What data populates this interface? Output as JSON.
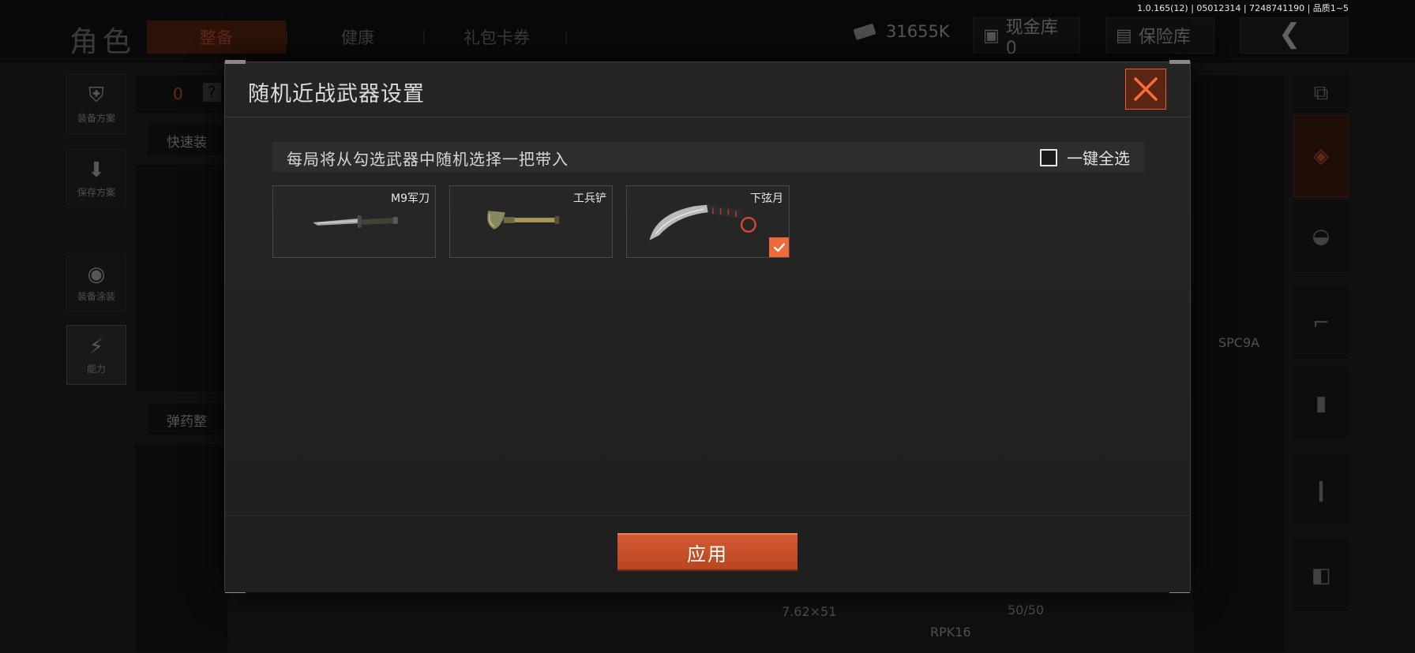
{
  "version": "1.0.165(12) | 05012314 | 7248741190 | 品质1~5",
  "header": {
    "title": "角色",
    "tabs": [
      {
        "label": "整备",
        "active": true
      },
      {
        "label": "健康",
        "active": false
      },
      {
        "label": "礼包卡券",
        "active": false
      }
    ],
    "currency": "31655K",
    "cash_vault": "现金库 0",
    "safe_box": "保险库"
  },
  "left_sidebar": [
    {
      "label": "装备方案",
      "icon": "vest-icon"
    },
    {
      "label": "保存方案",
      "icon": "download-icon"
    },
    {
      "label": "装备涂装",
      "icon": "helmet-icon"
    },
    {
      "label": "能力",
      "icon": "ability-icon"
    }
  ],
  "background": {
    "count": "0",
    "question": "?",
    "quick_equip": "快速装",
    "ammo_sort": "弹药整",
    "weapon_a": "SPC9A",
    "caliber": "7.62×51",
    "ammo_count": "50/50",
    "weapon_b": "RPK16"
  },
  "modal": {
    "title": "随机近战武器设置",
    "info": "每局将从勾选武器中随机选择一把带入",
    "select_all": "一键全选",
    "select_all_checked": false,
    "weapons": [
      {
        "name": "M9军刀",
        "checked": false
      },
      {
        "name": "工兵铲",
        "checked": false
      },
      {
        "name": "下弦月",
        "checked": true
      }
    ],
    "apply": "应用"
  },
  "colors": {
    "accent": "#ef6a3a",
    "accent_dark": "#5a2512",
    "panel": "#232323"
  }
}
